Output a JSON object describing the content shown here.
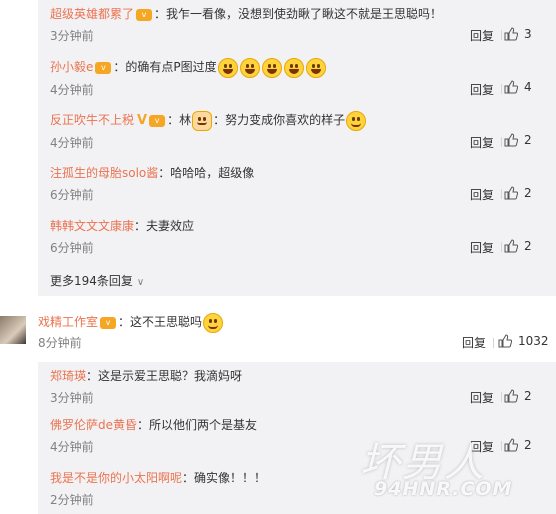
{
  "replies_top": [
    {
      "user": "超级英雄都累了",
      "text": "：我乍一看像，没想到使劲瞅了瞅这不就是王思聪吗！",
      "time": "3分钟前",
      "likes": "3",
      "emojis": []
    },
    {
      "user": "孙小毅e",
      "text": "：的确有点P图过度",
      "time": "4分钟前",
      "likes": "4",
      "emojis": [
        "laugh-emoji",
        "laugh-emoji",
        "laugh-emoji",
        "laugh-emoji",
        "laugh-emoji"
      ]
    },
    {
      "user": "反正吹牛不上税",
      "text_before": "：林",
      "text": "努力变成你喜欢的样子",
      "time": "4分钟前",
      "likes": "2",
      "emojis": [
        "cat-emoji"
      ],
      "emojis_after": [
        "smile-emoji"
      ]
    },
    {
      "user": "注孤生的母胎solo酱",
      "text": "：哈哈哈，超级像",
      "time": "6分钟前",
      "likes": "2",
      "emojis": []
    },
    {
      "user": "韩韩文文文康康",
      "text": "：夫妻效应",
      "time": "6分钟前",
      "likes": "2",
      "emojis": []
    }
  ],
  "more_replies": "更多194条回复",
  "main_comment": {
    "user": "戏精工作室",
    "text": "：这不王思聪吗",
    "time": "8分钟前",
    "likes": "1032",
    "emojis": [
      "smile-emoji"
    ]
  },
  "replies_bottom": [
    {
      "user": "郑琦瑛",
      "text": "：这是示爱王思聪？我滴妈呀",
      "time": "3分钟前",
      "likes": "2"
    },
    {
      "user": "佛罗伦萨de黄昏",
      "text": "：所以他们两个是基友",
      "time": "4分钟前",
      "likes": "2"
    },
    {
      "user": "我是不是你的小太阳啊呢",
      "text": "：确实像！！！",
      "time": "2分钟前",
      "likes": ""
    }
  ],
  "reply_label": "回复",
  "watermark": {
    "cn": "坏男人",
    "en": "94HNR.COM"
  },
  "colors": {
    "username": "#eb7350",
    "reply_bg": "#f2f2f5"
  }
}
